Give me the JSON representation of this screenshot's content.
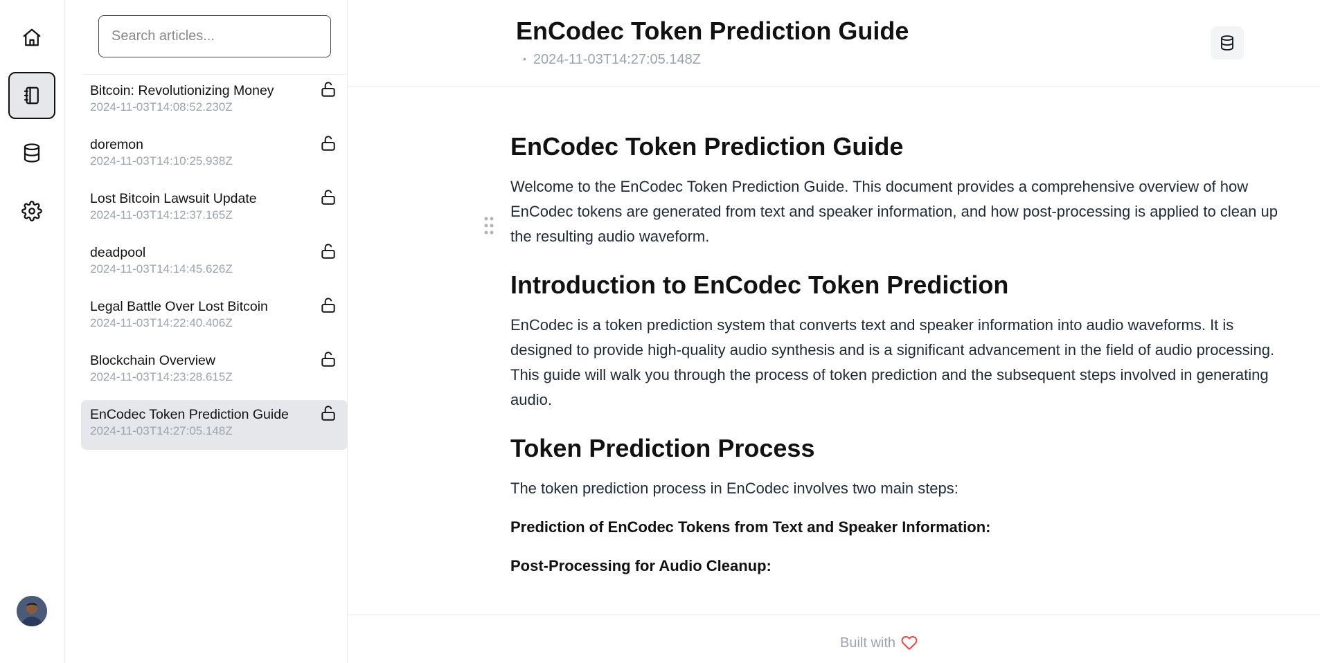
{
  "rail": {
    "items": [
      {
        "icon": "home-icon"
      },
      {
        "icon": "notebook-icon",
        "active": true
      },
      {
        "icon": "database-icon"
      },
      {
        "icon": "gear-icon"
      }
    ],
    "avatar": "user-avatar"
  },
  "sidebar": {
    "search_placeholder": "Search articles...",
    "articles": [
      {
        "title": "Bitcoin: Revolutionizing Money",
        "date": "2024-11-03T14:08:52.230Z"
      },
      {
        "title": "doremon",
        "date": "2024-11-03T14:10:25.938Z"
      },
      {
        "title": "Lost Bitcoin Lawsuit Update",
        "date": "2024-11-03T14:12:37.165Z"
      },
      {
        "title": "deadpool",
        "date": "2024-11-03T14:14:45.626Z"
      },
      {
        "title": "Legal Battle Over Lost Bitcoin",
        "date": "2024-11-03T14:22:40.406Z"
      },
      {
        "title": "Blockchain Overview",
        "date": "2024-11-03T14:23:28.615Z"
      },
      {
        "title": "EnCodec Token Prediction Guide",
        "date": "2024-11-03T14:27:05.148Z",
        "selected": true
      }
    ]
  },
  "header": {
    "title": "EnCodec Token Prediction Guide",
    "date": "2024-11-03T14:27:05.148Z"
  },
  "content": {
    "h1": "EnCodec Token Prediction Guide",
    "p1": "Welcome to the EnCodec Token Prediction Guide. This document provides a comprehensive overview of how EnCodec tokens are generated from text and speaker information, and how post-processing is applied to clean up the resulting audio waveform.",
    "h2a": "Introduction to EnCodec Token Prediction",
    "p2": "EnCodec is a token prediction system that converts text and speaker information into audio waveforms. It is designed to provide high-quality audio synthesis and is a significant advancement in the field of audio processing. This guide will walk you through the process of token prediction and the subsequent steps involved in generating audio.",
    "h2b": "Token Prediction Process",
    "p3": "The token prediction process in EnCodec involves two main steps:",
    "b1": "Prediction of EnCodec Tokens from Text and Speaker Information:",
    "b2": "Post-Processing for Audio Cleanup:"
  },
  "footer": {
    "text": "Built with",
    "icon": "heart-icon",
    "heart_color": "#ef4444"
  },
  "colors": {
    "selected_bg": "#e5e7eb",
    "muted_text": "#9ca3af"
  }
}
